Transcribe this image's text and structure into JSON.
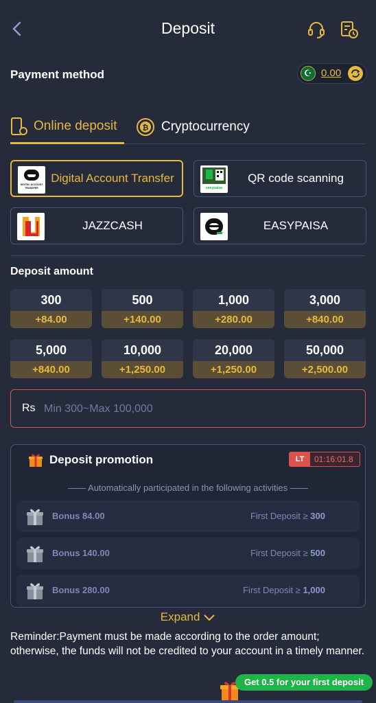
{
  "header": {
    "title": "Deposit"
  },
  "payment": {
    "title": "Payment method",
    "balance": "0.00"
  },
  "tabs": [
    {
      "label": "Online deposit",
      "active": true
    },
    {
      "label": "Cryptocurrency",
      "active": false
    }
  ],
  "methods": [
    {
      "label": "Digital Account Transfer",
      "logo_text": "DIGITAL ACCOUNT TRANSFER",
      "selected": true
    },
    {
      "label": "QR code scanning",
      "logo_text": "easypaisa",
      "selected": false
    },
    {
      "label": "JAZZCASH",
      "selected": false
    },
    {
      "label": "EASYPAISA",
      "selected": false
    }
  ],
  "amount": {
    "title": "Deposit amount",
    "options": [
      {
        "value": "300",
        "bonus": "+84.00"
      },
      {
        "value": "500",
        "bonus": "+140.00"
      },
      {
        "value": "1,000",
        "bonus": "+280.00"
      },
      {
        "value": "3,000",
        "bonus": "+840.00"
      },
      {
        "value": "5,000",
        "bonus": "+840.00"
      },
      {
        "value": "10,000",
        "bonus": "+1,250.00"
      },
      {
        "value": "20,000",
        "bonus": "+1,250.00"
      },
      {
        "value": "50,000",
        "bonus": "+2,500.00"
      }
    ],
    "currency": "Rs",
    "placeholder": "Min 300~Max 100,000"
  },
  "promotion": {
    "title": "Deposit promotion",
    "badge": "LT",
    "timer": "01:16:01.8",
    "subtitle": "—— Automatically participated in the following activities ——",
    "items": [
      {
        "bonus": "Bonus 84.00",
        "condition_prefix": "First Deposit ≥",
        "condition_value": "300"
      },
      {
        "bonus": "Bonus 140.00",
        "condition_prefix": "First Deposit ≥",
        "condition_value": "500"
      },
      {
        "bonus": "Bonus 280.00",
        "condition_prefix": "First Deposit ≥",
        "condition_value": "1,000"
      }
    ],
    "expand_label": "Expand"
  },
  "reminder": "Reminder:Payment must be made according to the order amount; otherwise, the funds will not be credited to your account in a timely manner.",
  "first_deposit_banner": "Get 0.5 for your first deposit",
  "colors": {
    "background": "#252b3b",
    "accent": "#e8b93f",
    "danger": "#d9534f",
    "bonus_bg": "#5a4e36"
  }
}
